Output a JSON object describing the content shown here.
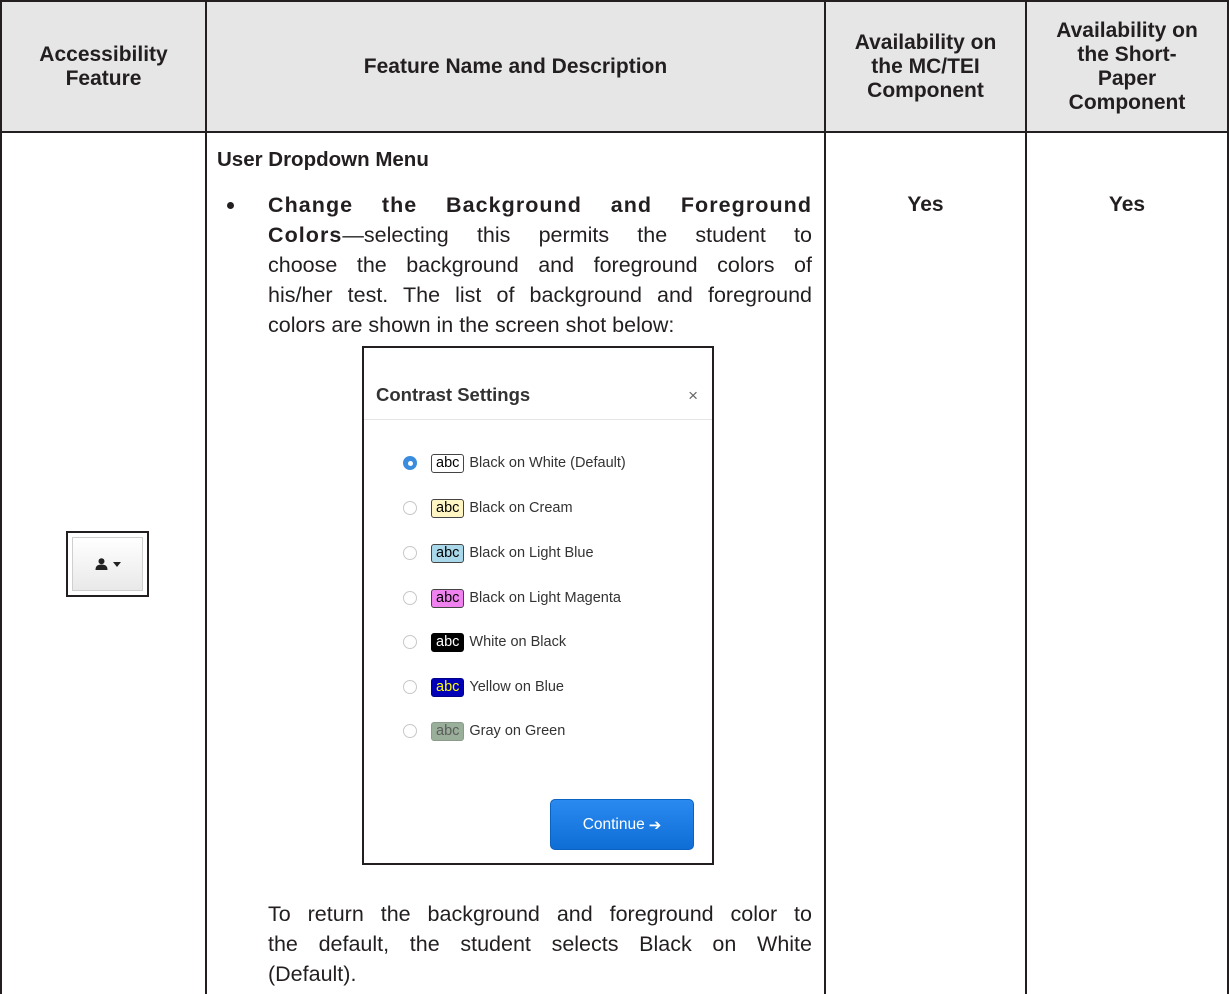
{
  "table": {
    "headers": {
      "accessibility_feature": [
        "Accessibility",
        "Feature"
      ],
      "feature_name": "Feature Name and Description",
      "mc_tei": [
        "Availability on",
        "the MC/TEI",
        "Component"
      ],
      "short_paper": [
        "Availability on",
        "the Short-",
        "Paper",
        "Component"
      ]
    },
    "row": {
      "section_title": "User Dropdown Menu",
      "bullet_bold": [
        "Change the Background and Foreground",
        "Colors"
      ],
      "bullet_lines": [
        "—selecting this permits the student to",
        "choose the background and foreground colors of",
        "his/her test. The list of background and foreground",
        "colors are shown in the screen shot below:"
      ],
      "return_lines": [
        "To return the background and foreground color to",
        "the default, the student selects Black on White",
        "(Default)."
      ],
      "mc_tei_value": "Yes",
      "short_paper_value": "Yes"
    }
  },
  "user_button": {
    "icon": "user-icon",
    "caret": "caret-down-icon"
  },
  "dialog": {
    "title": "Contrast Settings",
    "close_symbol": "×",
    "options": [
      {
        "abc": "abc",
        "label": "Black on White (Default)",
        "bg": "#ffffff",
        "fg": "#000000",
        "border": "#444444",
        "selected": true
      },
      {
        "abc": "abc",
        "label": "Black on Cream",
        "bg": "#fff6c4",
        "fg": "#000000",
        "border": "#444444",
        "selected": false
      },
      {
        "abc": "abc",
        "label": "Black on Light Blue",
        "bg": "#a9d8ea",
        "fg": "#000000",
        "border": "#444444",
        "selected": false
      },
      {
        "abc": "abc",
        "label": "Black on Light Magenta",
        "bg": "#ef82ee",
        "fg": "#000000",
        "border": "#444444",
        "selected": false
      },
      {
        "abc": "abc",
        "label": "White on Black",
        "bg": "#000000",
        "fg": "#ffffff",
        "border": "#000000",
        "selected": false
      },
      {
        "abc": "abc",
        "label": "Yellow on Blue",
        "bg": "#0000b8",
        "fg": "#ffff00",
        "border": "#00008a",
        "selected": false
      },
      {
        "abc": "abc",
        "label": "Gray on Green",
        "bg": "#9aaf9a",
        "fg": "#5c5c5c",
        "border": "#8b9a8b",
        "selected": false
      }
    ],
    "continue_label": "Continue",
    "continue_arrow": "➔"
  },
  "colors": {
    "header_bg": "#e6e6e7",
    "rule": "#231f20",
    "accent": "#1a7ae6"
  }
}
